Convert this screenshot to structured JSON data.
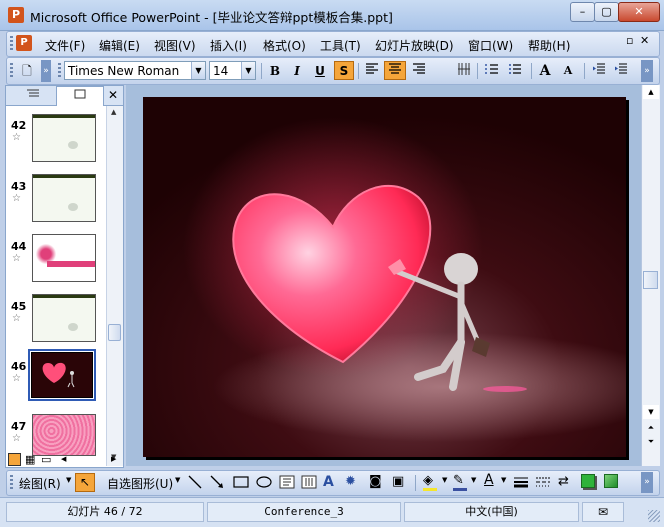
{
  "window": {
    "title": "Microsoft Office PowerPoint - [毕业论文答辩ppt模板合集.ppt]",
    "app_icon": "P",
    "minimize": "–",
    "maximize": "▢",
    "close": "✕"
  },
  "menubar": {
    "items": [
      "文件(F)",
      "编辑(E)",
      "视图(V)",
      "插入(I)",
      "格式(O)",
      "工具(T)",
      "幻灯片放映(D)",
      "窗口(W)",
      "帮助(H)"
    ]
  },
  "toolbar": {
    "font_name": "Times New Roman",
    "font_size": "14",
    "bold": "B",
    "italic": "I",
    "underline": "U",
    "shadow": "S",
    "increase_font": "A",
    "decrease_font": "A"
  },
  "slides": {
    "items": [
      {
        "number": "42"
      },
      {
        "number": "43"
      },
      {
        "number": "44"
      },
      {
        "number": "45"
      },
      {
        "number": "46"
      },
      {
        "number": "47"
      }
    ],
    "selected": "46",
    "star": "☆"
  },
  "drawbar": {
    "draw_label": "绘图(R)",
    "autoshape_label": "自选图形(U)"
  },
  "statusbar": {
    "slide_info": "幻灯片 46 / 72",
    "design": "Conference_3",
    "language": "中文(中国)"
  },
  "colors": {
    "accent": "#f5a53a",
    "heart": "#ff3a6a",
    "slide_bg": "#2a0507"
  }
}
